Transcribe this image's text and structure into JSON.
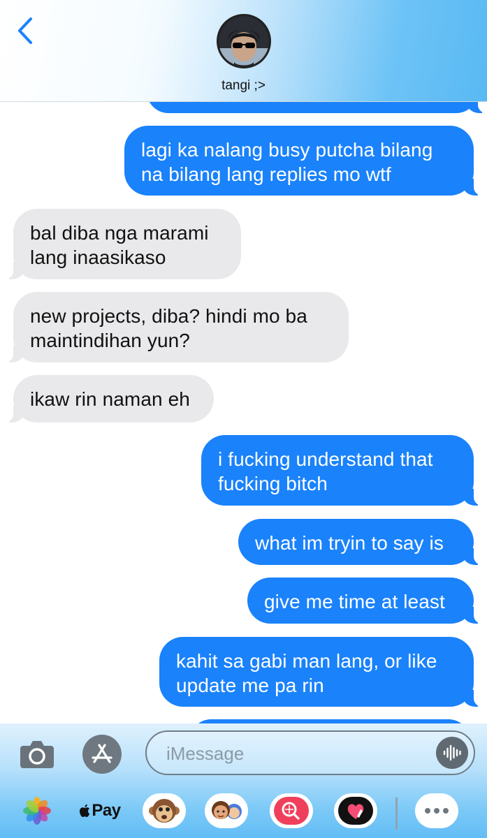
{
  "header": {
    "contact_name": "tangi ;>"
  },
  "messages": [
    {
      "sender": "me",
      "text": "lagi ka nalang busy putcha bilang na bilang lang replies mo wtf"
    },
    {
      "sender": "them",
      "text": "bal diba nga marami lang inaasikaso"
    },
    {
      "sender": "them",
      "text": "new projects, diba? hindi mo ba maintindihan yun?"
    },
    {
      "sender": "them",
      "text": "ikaw rin naman eh"
    },
    {
      "sender": "me",
      "text": "i fucking understand that fucking bitch"
    },
    {
      "sender": "me",
      "text": "what im tryin to say is"
    },
    {
      "sender": "me",
      "text": "give me time at least"
    },
    {
      "sender": "me",
      "text": "kahit sa gabi man lang, or like update me pa rin"
    }
  ],
  "composer": {
    "placeholder": "iMessage"
  },
  "app_drawer": {
    "items": [
      "photos-icon",
      "apple-pay",
      "monkey-emoji-icon",
      "memoji-icon",
      "search-images-icon",
      "digital-touch-icon",
      "more-icon"
    ],
    "apple_pay_label": "Pay"
  },
  "colors": {
    "sent_bubble": "#1a82fb",
    "received_bubble": "#e9e9eb",
    "accent": "#1a82fb"
  }
}
